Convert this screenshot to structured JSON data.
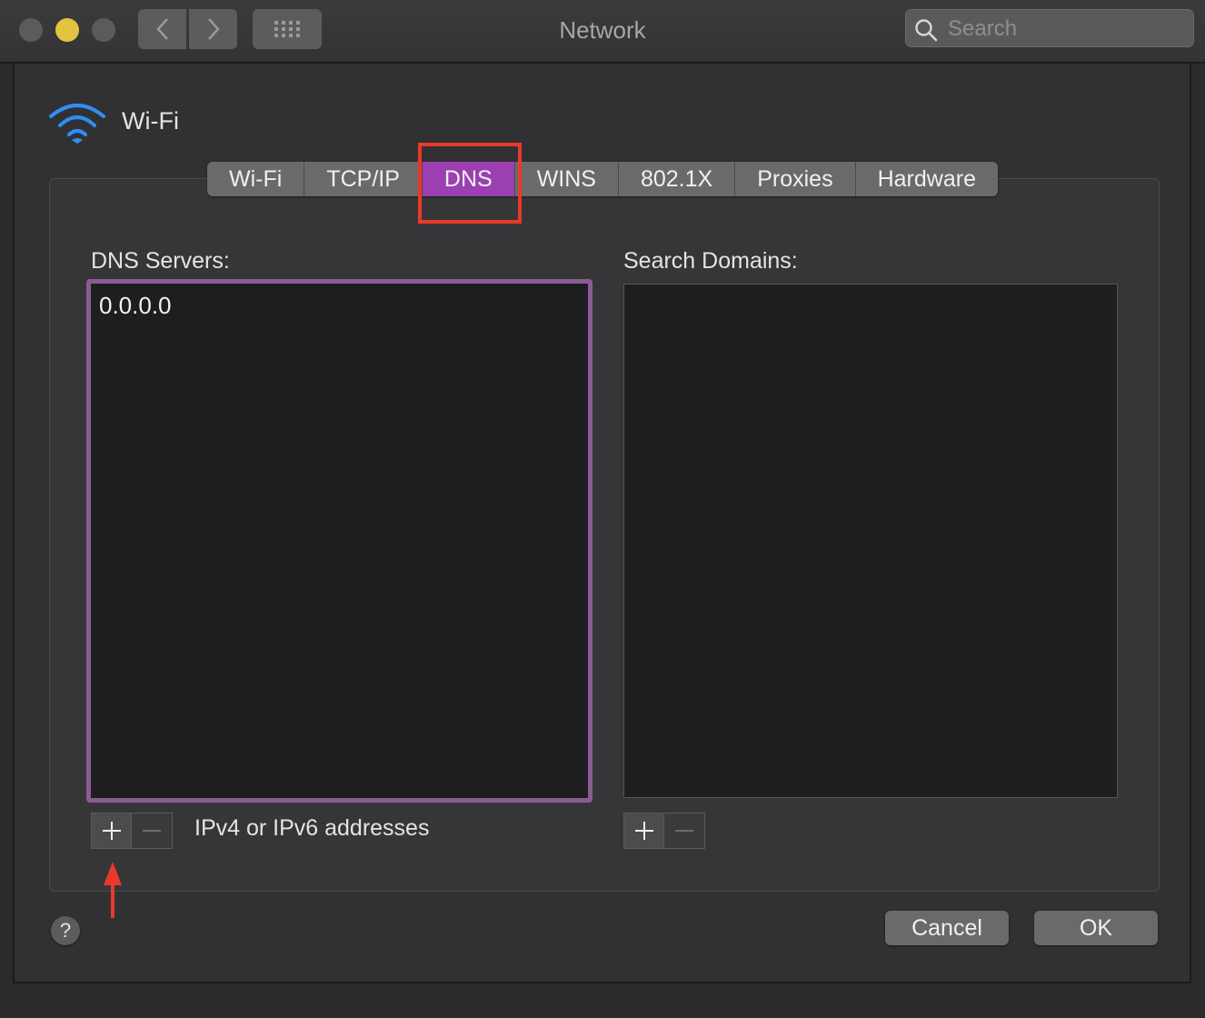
{
  "titlebar": {
    "title": "Network",
    "search_placeholder": "Search"
  },
  "header": {
    "title": "Wi-Fi",
    "icon": "wifi-icon",
    "accent": "#2f8ef5"
  },
  "tabs": [
    {
      "label": "Wi-Fi",
      "active": false
    },
    {
      "label": "TCP/IP",
      "active": false
    },
    {
      "label": "DNS",
      "active": true
    },
    {
      "label": "WINS",
      "active": false
    },
    {
      "label": "802.1X",
      "active": false
    },
    {
      "label": "Proxies",
      "active": false
    },
    {
      "label": "Hardware",
      "active": false
    }
  ],
  "dns": {
    "label": "DNS Servers:",
    "servers": [
      "0.0.0.0"
    ],
    "hint": "IPv4 or IPv6 addresses"
  },
  "domains": {
    "label": "Search Domains:",
    "items": []
  },
  "footer": {
    "help": "?",
    "cancel": "Cancel",
    "ok": "OK"
  },
  "colors": {
    "active_tab": "#9c3fb0",
    "annotation": "#e8392a",
    "focus_ring": "#8a5c94"
  }
}
